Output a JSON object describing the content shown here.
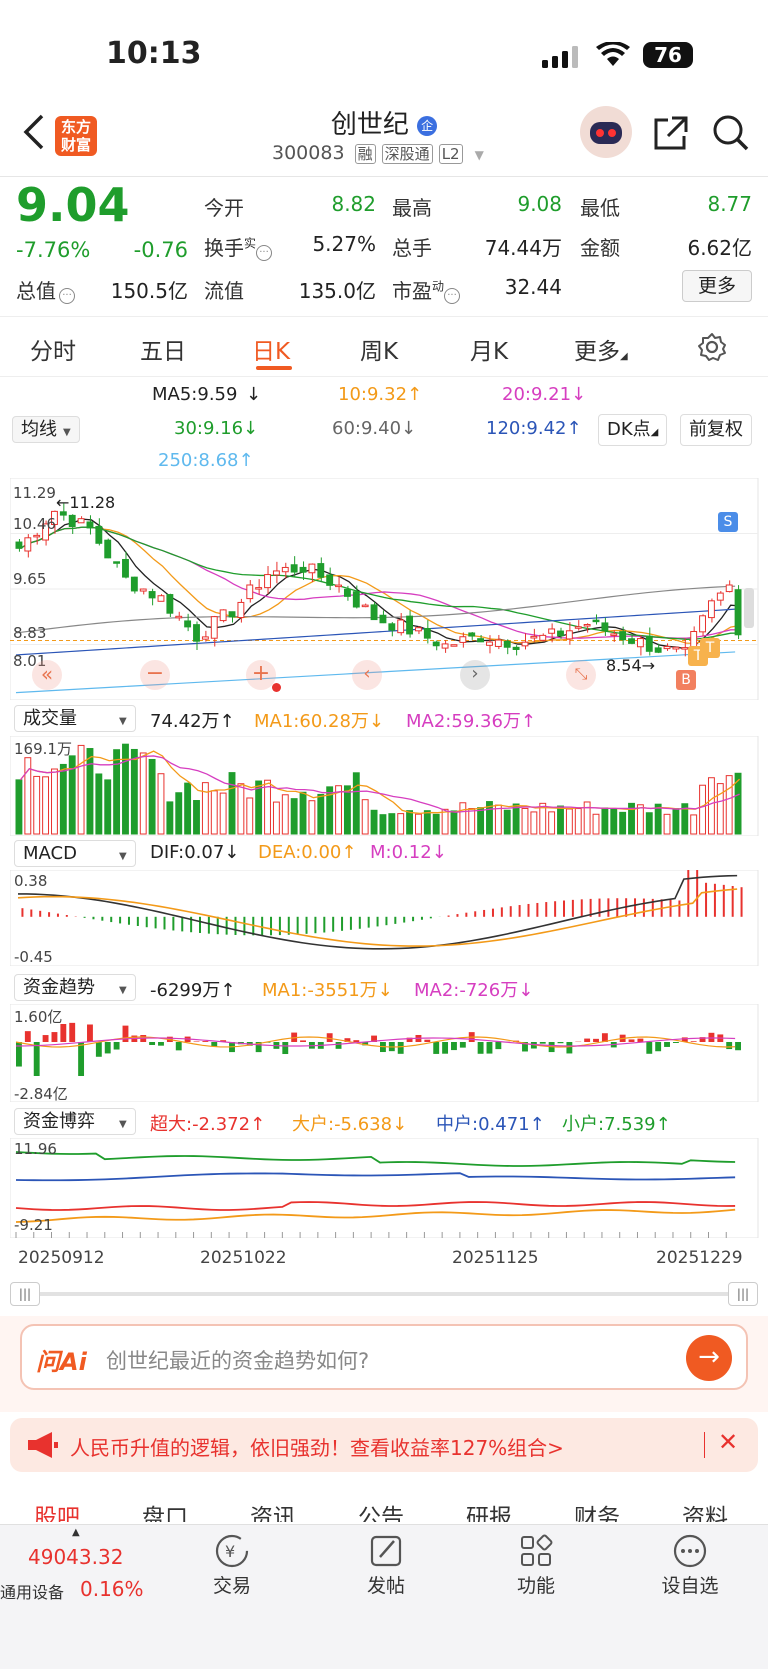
{
  "status_bar": {
    "time": "10:13",
    "battery": "76"
  },
  "header": {
    "title": "创世纪",
    "title_badge": "企",
    "code": "300083",
    "tags": [
      "融",
      "深股通",
      "L2"
    ],
    "logo_line1": "东方",
    "logo_line2": "财富"
  },
  "quote": {
    "price": "9.04",
    "change_pct": "-7.76%",
    "change": "-0.76",
    "fields": [
      {
        "label": "今开",
        "value": "8.82",
        "color": "#1f9d2c"
      },
      {
        "label": "最高",
        "value": "9.08",
        "color": "#1f9d2c"
      },
      {
        "label": "最低",
        "value": "8.77",
        "color": "#1f9d2c"
      },
      {
        "label": "换手",
        "sup": "实",
        "value": "5.27%",
        "color": "#222"
      },
      {
        "label": "总手",
        "value": "74.44万",
        "color": "#222"
      },
      {
        "label": "金额",
        "value": "6.62亿",
        "color": "#222"
      },
      {
        "label": "总值",
        "value": "150.5亿",
        "color": "#222"
      },
      {
        "label": "流值",
        "value": "135.0亿",
        "color": "#222"
      },
      {
        "label": "市盈",
        "sup": "动",
        "value": "32.44",
        "color": "#222"
      }
    ],
    "more_button": "更多"
  },
  "tabs": [
    "分时",
    "五日",
    "日K",
    "周K",
    "月K",
    "更多"
  ],
  "active_tab": "日K",
  "ma": {
    "dropdown": "均线",
    "ma5": "MA5:9.59",
    "ma10": "10:9.32",
    "ma20": "20:9.21",
    "ma30": "30:9.16",
    "ma60": "60:9.40",
    "ma120": "120:9.42",
    "ma250": "250:8.68",
    "dk_button": "DK点",
    "fq_button": "前复权",
    "colors": {
      "ma5": "#222222",
      "ma10": "#f39a19",
      "ma20": "#d63ec0",
      "ma30": "#1f9d2c",
      "ma60": "#888888",
      "ma120": "#2b55b7",
      "ma250": "#5fb9ee"
    }
  },
  "kline": {
    "y_labels": [
      "11.29",
      "10.46",
      "9.65",
      "8.83",
      "8.01"
    ],
    "high_marker": "11.28",
    "low_marker": "8.54",
    "signals": {
      "s": "S",
      "b": "B",
      "t": "T"
    },
    "nav_icons": [
      "double-left-icon",
      "zoom-out-icon",
      "zoom-in-icon",
      "left-icon",
      "right-icon",
      "fullscreen-icon"
    ]
  },
  "volume": {
    "dropdown": "成交量",
    "value": "74.42万",
    "ma1": "MA1:60.28万",
    "ma2": "MA2:59.36万",
    "y_top": "169.1万"
  },
  "macd": {
    "dropdown": "MACD",
    "dif": "DIF:0.07",
    "dea": "DEA:0.00",
    "m": "M:0.12",
    "y_top": "0.38",
    "y_bottom": "-0.45"
  },
  "fund_trend": {
    "dropdown": "资金趋势",
    "value": "-6299万",
    "ma1": "MA1:-3551万",
    "ma2": "MA2:-726万",
    "y_top": "1.60亿",
    "y_bottom": "-2.84亿"
  },
  "fund_game": {
    "dropdown": "资金博弈",
    "super": "超大:-2.372",
    "large": "大户:-5.638",
    "mid": "中户:0.471",
    "small": "小户:7.539",
    "y_top": "11.96",
    "y_bottom": "-9.21"
  },
  "x_dates": [
    "20250912",
    "20251022",
    "20251125",
    "20251229"
  ],
  "ai_box": {
    "brand": "问Ai",
    "placeholder": "创世纪最近的资金趋势如何?"
  },
  "banner": {
    "text": "人民币升值的逻辑，依旧强劲！查看收益率127%组合>"
  },
  "sub_tabs": [
    "股吧",
    "盘口",
    "资讯",
    "公告",
    "研报",
    "财务",
    "资料"
  ],
  "bottom_bar": {
    "index_value": "49043.32",
    "index_name": "通用设备",
    "index_change": "0.16%",
    "items": [
      "交易",
      "发帖",
      "功能",
      "设自选"
    ]
  }
}
